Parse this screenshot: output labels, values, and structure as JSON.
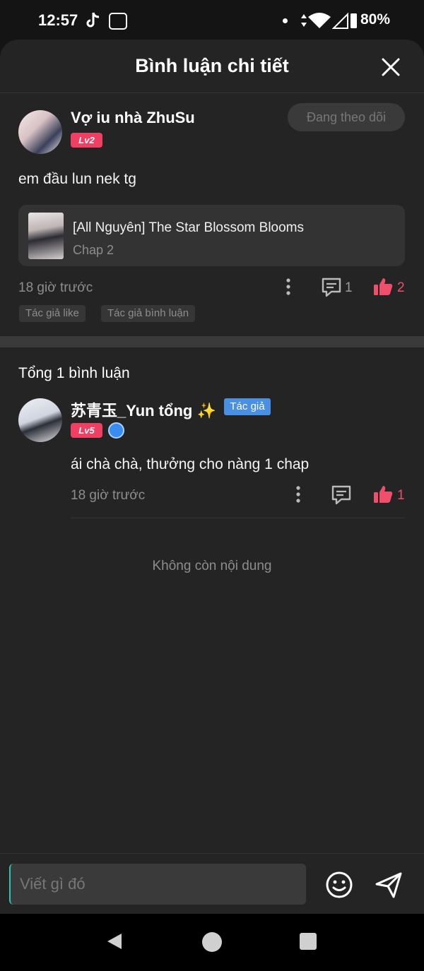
{
  "status_bar": {
    "time": "12:57",
    "battery": "80%",
    "icons": [
      "tiktok-icon",
      "app-notification-icon",
      "dot-icon",
      "data-arrows-icon",
      "wifi-icon",
      "signal-icon",
      "battery-icon"
    ]
  },
  "header": {
    "title": "Bình luận chi tiết",
    "close_icon": "close-icon"
  },
  "main_comment": {
    "username": "Vợ iu nhà ZhuSu",
    "level": "Lv2",
    "follow_label": "Đang theo dõi",
    "text": "em đầu lun nek tg",
    "story": {
      "title": "[All Nguyên] The Star Blossom Blooms",
      "chapter": "Chap 2"
    },
    "time": "18 giờ trước",
    "reply_count": "1",
    "like_count": "2",
    "chips": [
      "Tác giả like",
      "Tác giả bình luận"
    ]
  },
  "replies_section": {
    "total_label": "Tổng 1 bình luận",
    "empty_label": "Không còn nội dung",
    "reply": {
      "username": "苏青玉_Yun tổng",
      "sparkle": "✨",
      "author_badge": "Tác giả",
      "level": "Lv5",
      "text": "ái chà chà, thưởng cho nàng 1 chap",
      "time": "18 giờ trước",
      "like_count": "1"
    }
  },
  "composer": {
    "placeholder": "Viết gì đó"
  },
  "colors": {
    "background": "#242424",
    "accent_like": "#ef4f6a",
    "level_badge": "#ef3f62",
    "author_badge": "#4a90e2"
  }
}
